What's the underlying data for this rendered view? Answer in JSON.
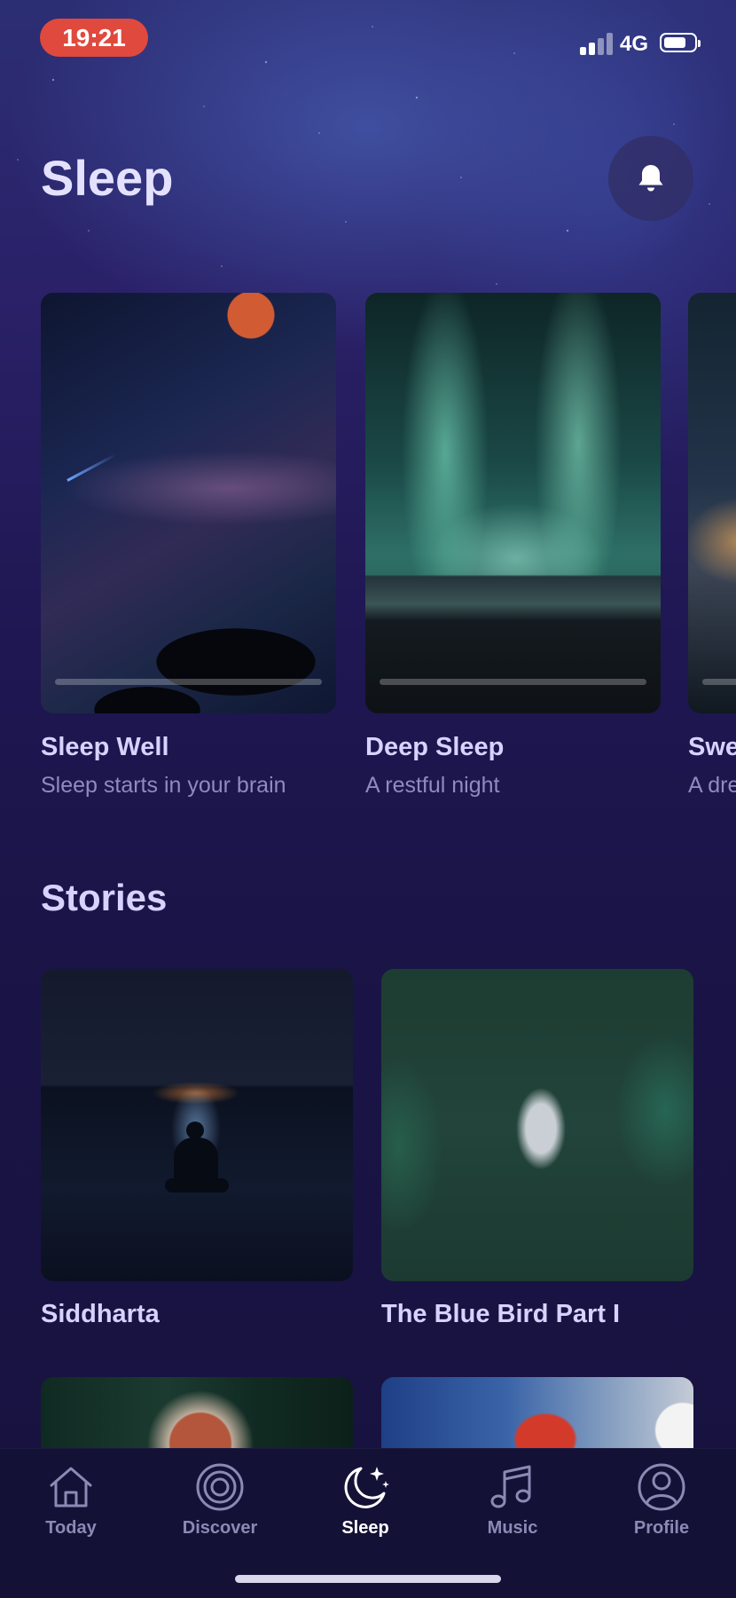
{
  "status_bar": {
    "time": "19:21",
    "network": "4G",
    "signal_bars": 2,
    "signal_bars_total": 4,
    "battery_level": 0.6
  },
  "header": {
    "title": "Sleep",
    "notification_icon": "bell-icon"
  },
  "featured": [
    {
      "title": "Sleep Well",
      "subtitle": "Sleep starts in your brain",
      "progress": 0
    },
    {
      "title": "Deep Sleep",
      "subtitle": "A restful night",
      "progress": 0
    },
    {
      "title": "Swe",
      "subtitle": "A dre",
      "progress": 0
    }
  ],
  "stories": {
    "title": "Stories",
    "items": [
      {
        "title": "Siddharta"
      },
      {
        "title": "The Blue Bird Part I"
      }
    ]
  },
  "tab_bar": {
    "active": "Sleep",
    "tabs": [
      {
        "label": "Today",
        "icon": "home-icon"
      },
      {
        "label": "Discover",
        "icon": "discover-icon"
      },
      {
        "label": "Sleep",
        "icon": "moon-stars-icon"
      },
      {
        "label": "Music",
        "icon": "music-note-icon"
      },
      {
        "label": "Profile",
        "icon": "profile-icon"
      }
    ]
  },
  "colors": {
    "background": "#1b1545",
    "time_pill": "#e0493d",
    "title": "#e4e1ff",
    "subtitle": "#8e8bc0",
    "tab_inactive": "#8c89b5",
    "tab_active": "#ffffff"
  }
}
